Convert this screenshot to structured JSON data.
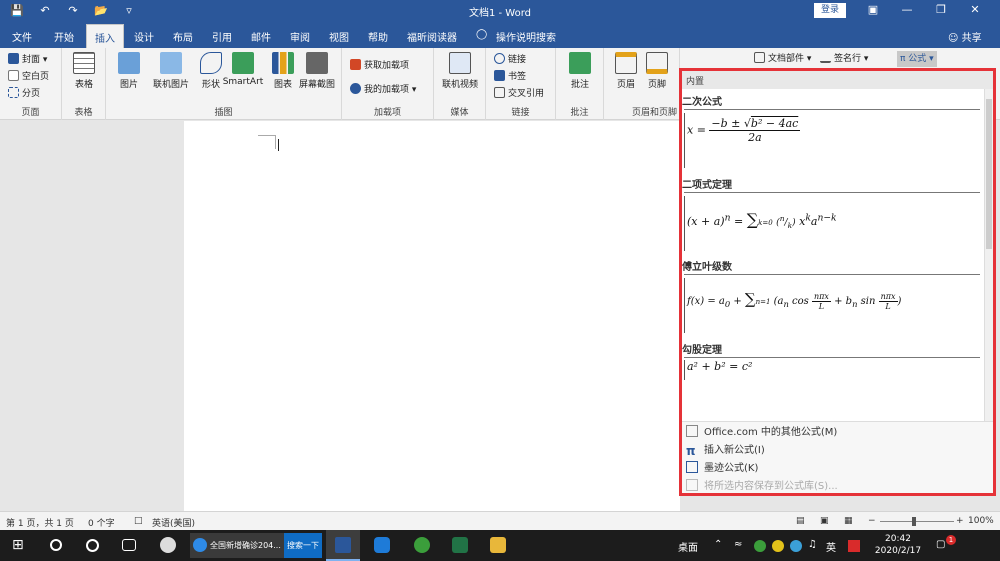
{
  "window": {
    "title": "文档1 - Word",
    "login_label": "登录"
  },
  "tabs": [
    "文件",
    "开始",
    "插入",
    "设计",
    "布局",
    "引用",
    "邮件",
    "审阅",
    "视图",
    "帮助",
    "福昕阅读器"
  ],
  "tell_me": "操作说明搜索",
  "share_label": "共享",
  "ribbon": {
    "pages": {
      "cover": "封面",
      "blank": "空白页",
      "break": "分页",
      "label": "页面"
    },
    "tables": {
      "table": "表格",
      "label": "表格"
    },
    "illustrations": {
      "picture": "图片",
      "online_picture": "联机图片",
      "shapes": "形状",
      "smartart": "SmartArt",
      "chart": "图表",
      "screenshot": "屏幕截图",
      "label": "插图"
    },
    "addins": {
      "get": "获取加载项",
      "mine": "我的加载项",
      "label": "加载项"
    },
    "media": {
      "online_video": "联机视频",
      "label": "媒体"
    },
    "links": {
      "link": "链接",
      "bookmark": "书签",
      "crossref": "交叉引用",
      "label": "链接"
    },
    "comments": {
      "comment": "批注",
      "label": "批注"
    },
    "header_footer": {
      "header": "页眉",
      "footer": "页脚",
      "label": "页眉和页脚"
    },
    "text": {
      "doc_parts": "文档部件",
      "signature": "签名行",
      "equation": "公式"
    }
  },
  "equation_panel": {
    "header": "内置",
    "sections": [
      {
        "title": "二次公式"
      },
      {
        "title": "二项式定理"
      },
      {
        "title": "傅立叶级数"
      },
      {
        "title": "勾股定理"
      }
    ],
    "menu": [
      {
        "label": "Office.com 中的其他公式(M)",
        "icon": "office-icon"
      },
      {
        "label": "插入新公式(I)",
        "icon": "pi-icon"
      },
      {
        "label": "墨迹公式(K)",
        "icon": "ink-icon"
      },
      {
        "label": "将所选内容保存到公式库(S)...",
        "icon": "save-icon"
      }
    ]
  },
  "statusbar": {
    "page": "第 1 页，共 1 页",
    "words": "0 个字",
    "language": "英语(美国)",
    "zoom": "100%"
  },
  "taskbar": {
    "browser_title": "全国新增确诊204...",
    "search_button": "搜索一下",
    "desktop_label": "桌面",
    "ime": "英",
    "time": "20:42",
    "date": "2020/2/17",
    "notification_count": "1"
  }
}
